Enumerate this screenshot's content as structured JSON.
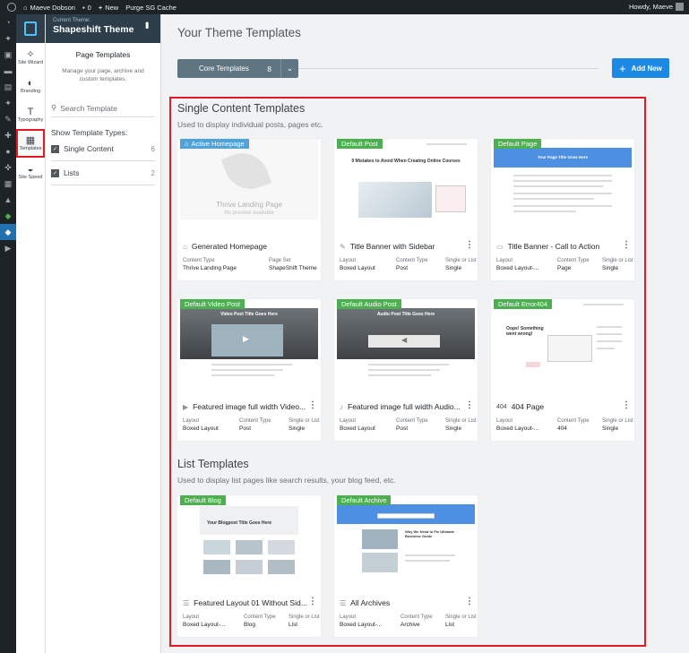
{
  "admin_bar": {
    "site_name": "Maeve Dobson",
    "comments": "0",
    "new_label": "New",
    "purge_label": "Purge SG Cache",
    "howdy": "Howdy, Maeve"
  },
  "rail": {
    "items": [
      {
        "label": "Site Wizard",
        "icon": "magic-wand-icon"
      },
      {
        "label": "Branding",
        "icon": "palette-icon"
      },
      {
        "label": "Typography",
        "icon": "typography-icon"
      },
      {
        "label": "Templates",
        "icon": "templates-icon"
      },
      {
        "label": "Site Speed",
        "icon": "speedometer-icon"
      }
    ]
  },
  "panel": {
    "theme_caption": "Current Theme:",
    "theme_name": "Shapeshift Theme",
    "title": "Page Templates",
    "description": "Manage your page, archive and custom templates.",
    "search_placeholder": "Search Template",
    "show_types_label": "Show Template Types:",
    "types": [
      {
        "label": "Single Content",
        "count": "6"
      },
      {
        "label": "Lists",
        "count": "2"
      }
    ]
  },
  "main": {
    "heading": "Your Theme Templates",
    "core_tab_label": "Core Templates",
    "core_tab_count": "8",
    "add_new_label": "Add New",
    "single": {
      "title": "Single Content Templates",
      "description": "Used to display individual posts, pages etc."
    },
    "list": {
      "title": "List Templates",
      "description": "Used to display list pages like search results, your blog feed, etc."
    }
  },
  "cards": [
    {
      "badge": "Active Homepage",
      "badge_color": "#4fa3d9",
      "title": "Generated Homepage",
      "icon": "home-icon",
      "m1_label": "Content Type",
      "m1_value": "Thrive Landing Page",
      "m2_label": "Page Set",
      "m2_value": "ShapeShift Theme",
      "m3_label": "",
      "m3_value": "",
      "thumb_title": "Thrive Landing Page",
      "thumb_sub": "No preview available"
    },
    {
      "badge": "Default Post",
      "badge_color": "#4caf50",
      "title": "Title Banner with Sidebar",
      "icon": "pen-icon",
      "m1_label": "Layout",
      "m1_value": "Boxed Layout",
      "m2_label": "Content Type",
      "m2_value": "Post",
      "m3_label": "Single or List",
      "m3_value": "Single",
      "thumb_title": "9 Mistakes to Avoid When Creating Online Courses"
    },
    {
      "badge": "Default Page",
      "badge_color": "#4caf50",
      "title": "Title Banner - Call to Action",
      "icon": "page-icon",
      "m1_label": "Layout",
      "m1_value": "Boxed Layout-...",
      "m2_label": "Content Type",
      "m2_value": "Page",
      "m3_label": "Single or List",
      "m3_value": "Single",
      "thumb_title": "Your Page Title Goes Here"
    },
    {
      "badge": "Default Video Post",
      "badge_color": "#4caf50",
      "title": "Featured image full width Video...",
      "icon": "video-icon",
      "m1_label": "Layout",
      "m1_value": "Boxed Layout",
      "m2_label": "Content Type",
      "m2_value": "Post",
      "m3_label": "Single or List",
      "m3_value": "Single",
      "thumb_title": "Video Post Title Goes Here"
    },
    {
      "badge": "Default Audio Post",
      "badge_color": "#4caf50",
      "title": "Featured image full width Audio...",
      "icon": "audio-icon",
      "m1_label": "Layout",
      "m1_value": "Boxed Layout",
      "m2_label": "Content Type",
      "m2_value": "Post",
      "m3_label": "Single or List",
      "m3_value": "Single",
      "thumb_title": "Audio Post Title Goes Here"
    },
    {
      "badge": "Default Error404",
      "badge_color": "#4caf50",
      "title": "404 Page",
      "icon_text": "404",
      "m1_label": "Layout",
      "m1_value": "Boxed Layout-...",
      "m2_label": "Content Type",
      "m2_value": "404",
      "m3_label": "Single or List",
      "m3_value": "Single",
      "thumb_title": "Oops! Something went wrong!"
    },
    {
      "badge": "Default Blog",
      "badge_color": "#4caf50",
      "title": "Featured Layout 01 Without Sid...",
      "icon": "list-icon",
      "m1_label": "Layout",
      "m1_value": "Boxed Layout-...",
      "m2_label": "Content Type",
      "m2_value": "Blog",
      "m3_label": "Single or List",
      "m3_value": "List",
      "thumb_title": "Your Blogpost Title Goes Here"
    },
    {
      "badge": "Default Archive",
      "badge_color": "#4caf50",
      "title": "All Archives",
      "icon": "list-icon",
      "m1_label": "Layout",
      "m1_value": "Boxed Layout-...",
      "m2_label": "Content Type",
      "m2_value": "Archive",
      "m3_label": "Single or List",
      "m3_value": "List",
      "thumb_title": "Why We Need to Fix Ultimate Business Guide"
    }
  ]
}
